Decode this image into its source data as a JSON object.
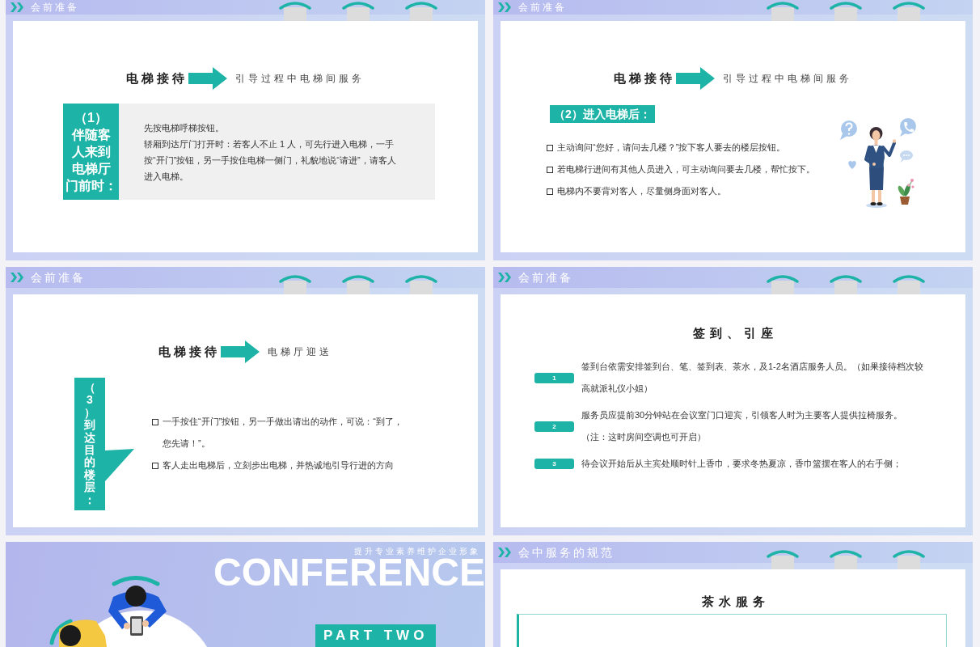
{
  "slides": [
    {
      "kind": "callout",
      "header": "会前准备",
      "title": "电梯接待",
      "subtitle": "引导过程中电梯间服务",
      "label_lines": [
        "（1）",
        "伴随客",
        "人来到",
        "电梯厅",
        "门前时："
      ],
      "paragraphs": [
        "先按电梯呼梯按钮。",
        "轿厢到达厅门打开时：若客人不止 1 人，可先行进入电梯，一手按“开门”按钮，另一手按住电梯一侧门，礼貌地说“请进”，请客人进入电梯。"
      ]
    },
    {
      "kind": "list_figure",
      "header": "会前准备",
      "title": "电梯接待",
      "subtitle": "引导过程中电梯间服务",
      "section_label": "（2）进入电梯后：",
      "bullets": [
        "主动询问“您好，请问去几楼？”按下客人要去的楼层按钮。",
        "若电梯行进间有其他人员进入，可主动询问要去几楼，帮忙按下。",
        "电梯内不要背对客人，尽量侧身面对客人。"
      ]
    },
    {
      "kind": "flag_list",
      "header": "会前准备",
      "title": "电梯接待",
      "subtitle": "电梯厅迎送",
      "flag_label": "（3）到达目的楼层：",
      "bullets": [
        "一手按住“开门”按钮，另一手做出请出的动作，可说：“到了，您先请！”。",
        "客人走出电梯后，立刻步出电梯，并热诚地引导行进的方向"
      ]
    },
    {
      "kind": "numbered",
      "header": "会前准备",
      "title": "签到、引座",
      "items": [
        {
          "number": "1",
          "text": "签到台依需安排签到台、笔、签到表、茶水，及1-2名酒店服务人员。（如果接待档次较高就派礼仪小姐）"
        },
        {
          "number": "2",
          "text": "服务员应提前30分钟站在会议室门口迎宾，引领客人时为主要客人提供拉椅服务。（注：这时房间空调也可开启）"
        },
        {
          "number": "3",
          "text": "待会议开始后从主宾处顺时针上香巾，要求冬热夏凉，香巾篮摆在客人的右手侧；"
        }
      ]
    },
    {
      "kind": "cover",
      "background_word": "CONFERENCE",
      "tagline": "提升专业素养维护企业形象",
      "part_label": "PART TWO"
    },
    {
      "kind": "framed",
      "header": "会中服务的规范",
      "title": "茶水服务"
    }
  ]
}
